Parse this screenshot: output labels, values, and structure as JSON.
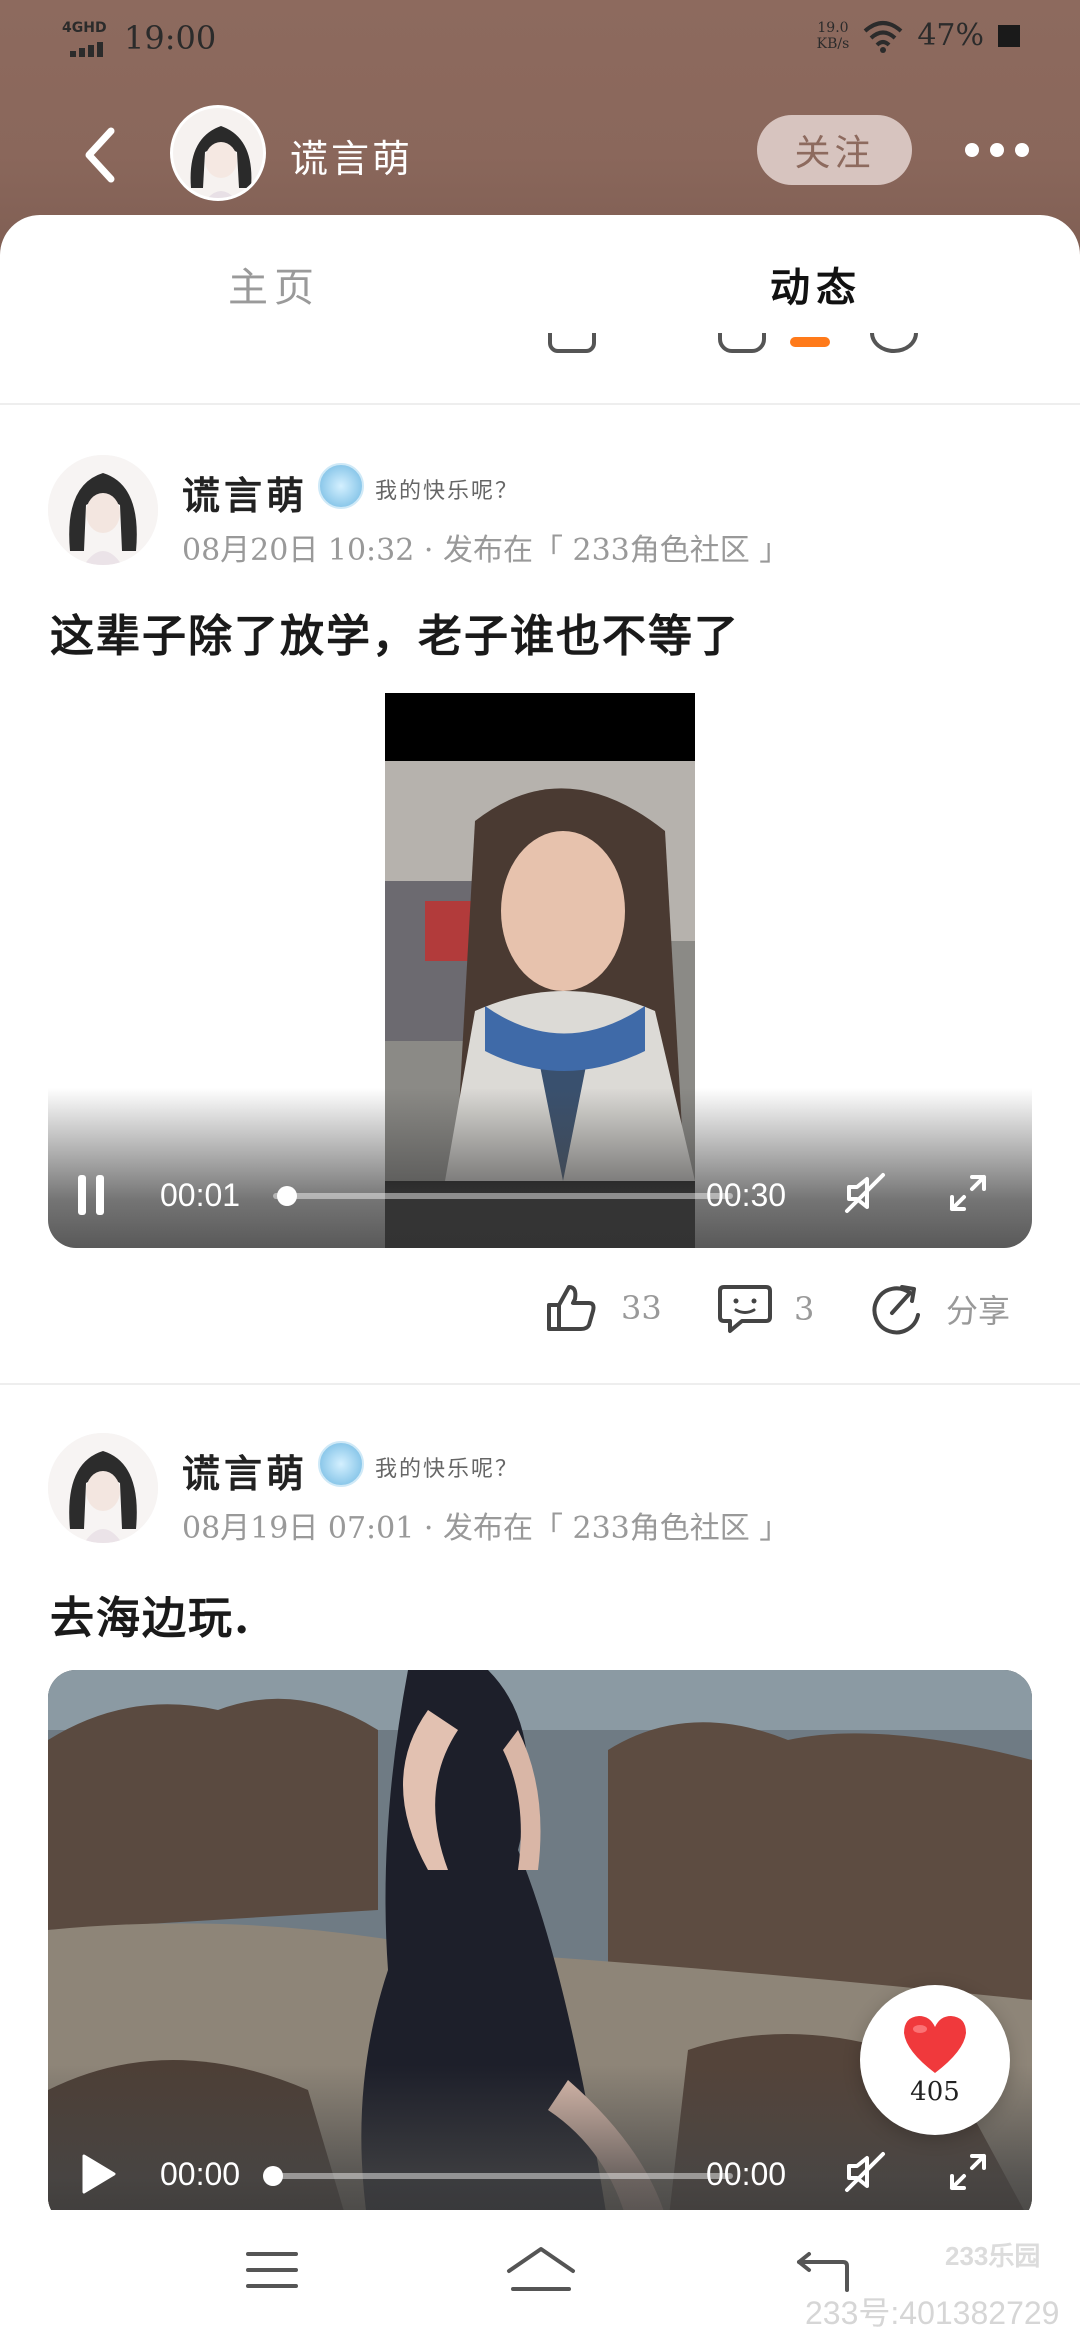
{
  "status_bar": {
    "network": "4GHD",
    "time": "19:00",
    "speed_value": "19.0",
    "speed_unit": "KB/s",
    "battery": "47%"
  },
  "nav": {
    "profile_name": "谎言萌",
    "follow_label": "关注"
  },
  "tabs": [
    {
      "label": "主页",
      "active": false
    },
    {
      "label": "动态",
      "active": true
    }
  ],
  "posts": [
    {
      "author": "谎言萌",
      "badge_text": "我的快乐呢？",
      "meta": "08月20日 10:32 · 发布在「 233角色社区 」",
      "text": "这辈子除了放学，老子谁也不等了",
      "media": {
        "type": "video",
        "current_time": "00:01",
        "duration": "00:30",
        "progress": 0.03,
        "state": "playing"
      },
      "likes": "33",
      "comments": "3",
      "share_label": "分享"
    },
    {
      "author": "谎言萌",
      "badge_text": "我的快乐呢？",
      "meta": "08月19日 07:01 · 发布在「 233角色社区 」",
      "text": "去海边玩.",
      "media": {
        "type": "video",
        "current_time": "00:00",
        "duration": "00:00",
        "progress": 0,
        "state": "paused"
      }
    }
  ],
  "like_fab": {
    "count": "405",
    "color": "#f0393c"
  },
  "watermark": {
    "logo": "233乐园",
    "text": "233号:401382729"
  },
  "colors": {
    "header_brown": "#8d6a5e",
    "accent_orange": "#ff7a1a",
    "follow_bg": "#d7c4bf"
  }
}
